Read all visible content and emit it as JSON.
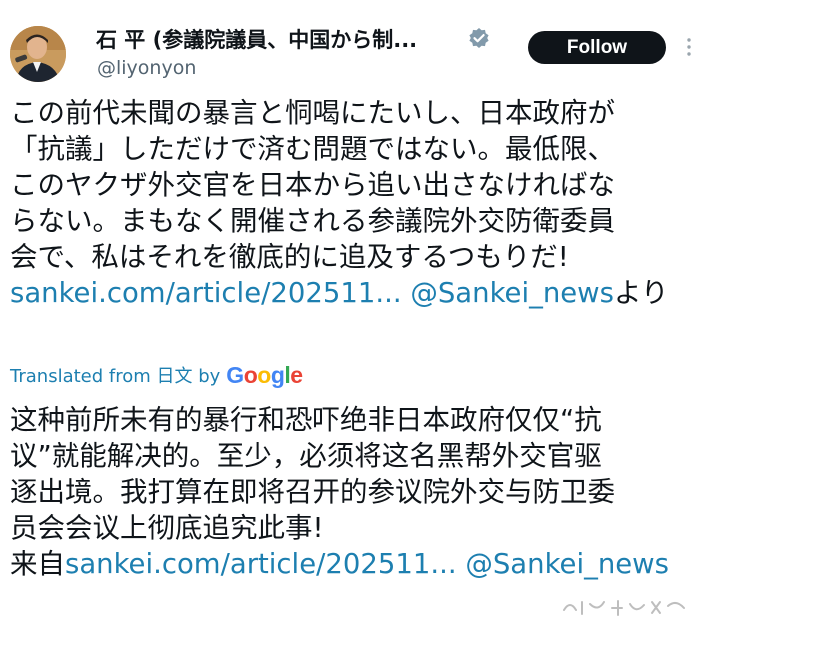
{
  "author": {
    "display_name": "石 平 (参議院議員、中国から制...",
    "handle": "@liyonyon",
    "verified_icon": "verified-badge-icon",
    "avatar_icon": "avatar"
  },
  "follow_button": {
    "label": "Follow"
  },
  "more_icon": "more-vertical-icon",
  "tweet": {
    "lines": [
      "この前代未聞の暴言と恫喝にたいし、日本政府が",
      "「抗議」しただけで済む問題ではない。最低限、",
      "このヤクザ外交官を日本から追い出さなければな",
      "らない。まもなく開催される参議院外交防衛委員",
      "会で、私はそれを徹底的に追及するつもりだ!"
    ],
    "link": "sankei.com/article/202511...",
    "mention": "@Sankei_news",
    "suffix": "より"
  },
  "translation": {
    "label": "Translated from 日文 by",
    "provider": "Google",
    "lines": [
      "这种前所未有的暴行和恐吓绝非日本政府仅仅“抗",
      "议”就能解决的。至少，必须将这名黑帮外交官驱",
      "逐出境。我打算在即将召开的参议院外交与防卫委",
      "员会会议上彻底追究此事!"
    ],
    "prefix": "来自",
    "link": "sankei.com/article/202511...",
    "mention": "@Sankei_news"
  },
  "colors": {
    "link": "#1d7fb0",
    "text": "#0f1419",
    "secondary": "#536471",
    "follow_bg": "#0f1419",
    "verified": "#829aab"
  }
}
